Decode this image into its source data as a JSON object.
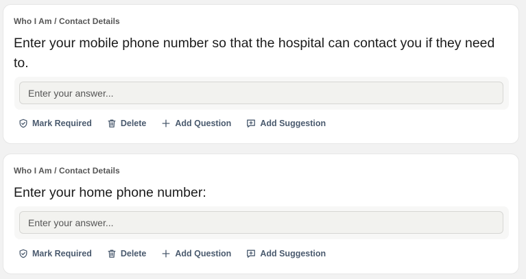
{
  "cards": [
    {
      "breadcrumb": "Who I Am / Contact Details",
      "question": "Enter your mobile phone number so that the hospital can contact you if they need to.",
      "answer_placeholder": "Enter your answer...",
      "actions": {
        "mark_required": "Mark Required",
        "delete": "Delete",
        "add_question": "Add Question",
        "add_suggestion": "Add Suggestion"
      }
    },
    {
      "breadcrumb": "Who I Am / Contact Details",
      "question": "Enter your home phone number:",
      "answer_placeholder": "Enter your answer...",
      "actions": {
        "mark_required": "Mark Required",
        "delete": "Delete",
        "add_question": "Add Question",
        "add_suggestion": "Add Suggestion"
      }
    }
  ],
  "icons": {
    "mark_required": "shield-check-icon",
    "delete": "trash-icon",
    "add_question": "plus-icon",
    "add_suggestion": "message-plus-icon"
  }
}
